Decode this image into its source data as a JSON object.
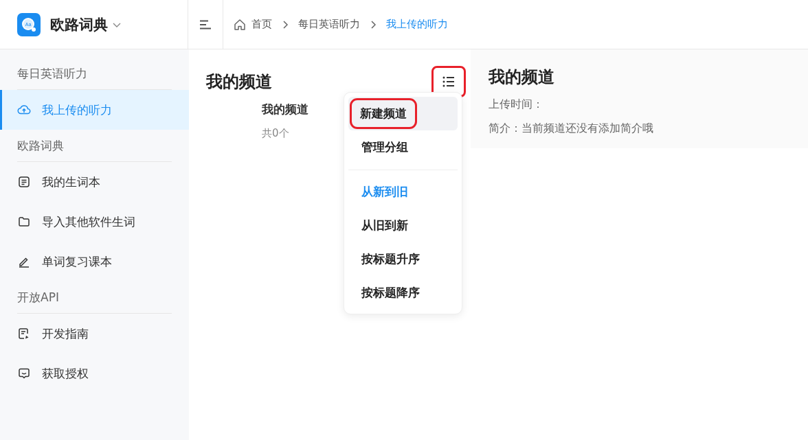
{
  "app": {
    "name": "欧路词典",
    "logo_text": "Aa"
  },
  "breadcrumb": [
    {
      "label": "首页",
      "kind": "home",
      "selected": false
    },
    {
      "label": "每日英语听力",
      "kind": "plain",
      "selected": false
    },
    {
      "label": "我上传的听力",
      "kind": "plain",
      "selected": true
    }
  ],
  "sidebar": {
    "sections": [
      {
        "title": "每日英语听力",
        "items": [
          {
            "label": "我上传的听力",
            "kind": "upload",
            "selected": true
          }
        ]
      },
      {
        "title": "欧路词典",
        "items": [
          {
            "label": "我的生词本",
            "kind": "note",
            "selected": false
          },
          {
            "label": "导入其他软件生词",
            "kind": "folder",
            "selected": false
          },
          {
            "label": "单词复习课本",
            "kind": "pen",
            "selected": false
          }
        ]
      },
      {
        "title": "开放API",
        "items": [
          {
            "label": "开发指南",
            "kind": "guide",
            "selected": false
          },
          {
            "label": "获取授权",
            "kind": "chat",
            "selected": false
          }
        ]
      }
    ]
  },
  "channels_panel": {
    "title": "我的频道",
    "menu_button": {
      "highlighted": true
    },
    "channel": {
      "name": "我的频道",
      "count": "共0个"
    }
  },
  "menu": {
    "actions": [
      {
        "label": "新建频道",
        "hovered": true,
        "highlighted": true
      },
      {
        "label": "管理分组",
        "hovered": false,
        "highlighted": false
      }
    ],
    "sort_options": [
      {
        "label": "从新到旧",
        "selected": true
      },
      {
        "label": "从旧到新",
        "selected": false
      },
      {
        "label": "按标题升序",
        "selected": false
      },
      {
        "label": "按标题降序",
        "selected": false
      }
    ]
  },
  "detail": {
    "title": "我的频道",
    "upload_time": "上传时间：",
    "intro": "简介：当前频道还没有添加简介哦"
  }
}
